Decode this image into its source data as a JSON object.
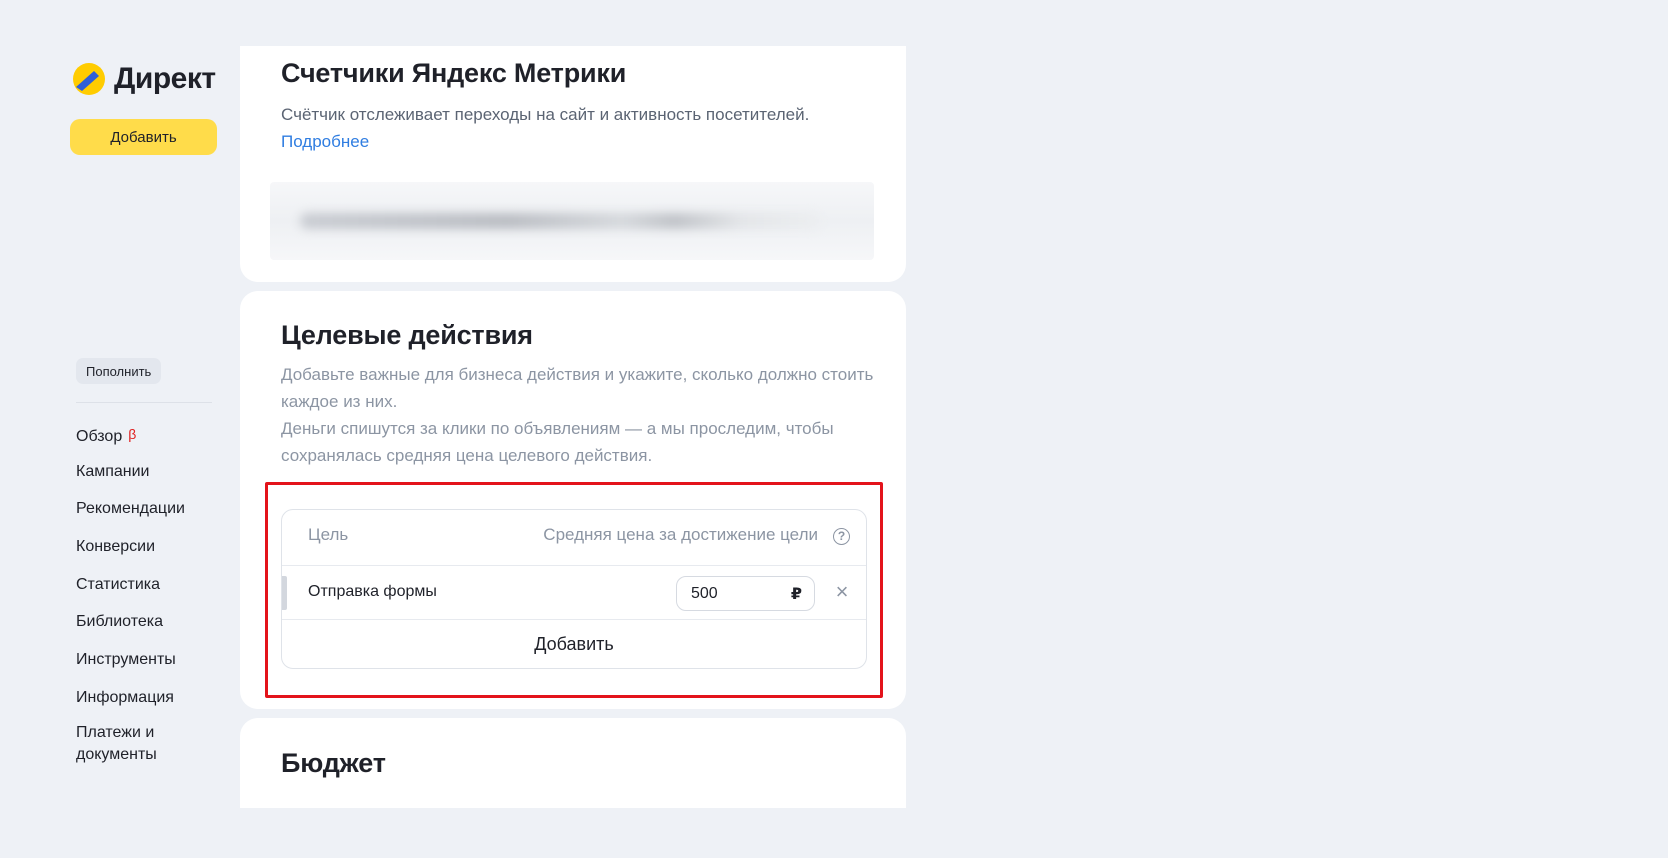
{
  "sidebar": {
    "logo_text": "Директ",
    "add_button": "Добавить",
    "topup_button": "Пополнить",
    "nav": [
      {
        "label": "Обзор",
        "badge": "β"
      },
      {
        "label": "Кампании"
      },
      {
        "label": "Рекомендации"
      },
      {
        "label": "Конверсии"
      },
      {
        "label": "Статистика"
      },
      {
        "label": "Библиотека"
      },
      {
        "label": "Инструменты"
      },
      {
        "label": "Информация"
      },
      {
        "label_line1": "Платежи и",
        "label_line2": "документы"
      }
    ]
  },
  "metrika": {
    "title": "Счетчики Яндекс Метрики",
    "description": "Счётчик отслеживает переходы на сайт и активность посетителей.",
    "more_link": "Подробнее"
  },
  "goals": {
    "title": "Целевые действия",
    "description_1": "Добавьте важные для бизнеса действия и укажите, сколько должно стоить каждое из них.",
    "description_2": "Деньги спишутся за клики по объявлениям — а мы проследим, чтобы сохранялась средняя цена целевого действия.",
    "table": {
      "col_goal": "Цель",
      "col_price": "Средняя цена за достижение цели",
      "rows": [
        {
          "goal": "Отправка формы",
          "price": "500",
          "currency": "₽"
        }
      ],
      "add_label": "Добавить"
    }
  },
  "budget": {
    "title": "Бюджет"
  },
  "colors": {
    "accent_yellow": "#ffdc4a",
    "link_blue": "#2f7de1",
    "highlight_red": "#e3131b",
    "beta_red": "#e02020"
  },
  "icons": [
    "yandex-direct-logo-icon",
    "help-circle-icon",
    "close-icon",
    "drag-handle-icon"
  ]
}
